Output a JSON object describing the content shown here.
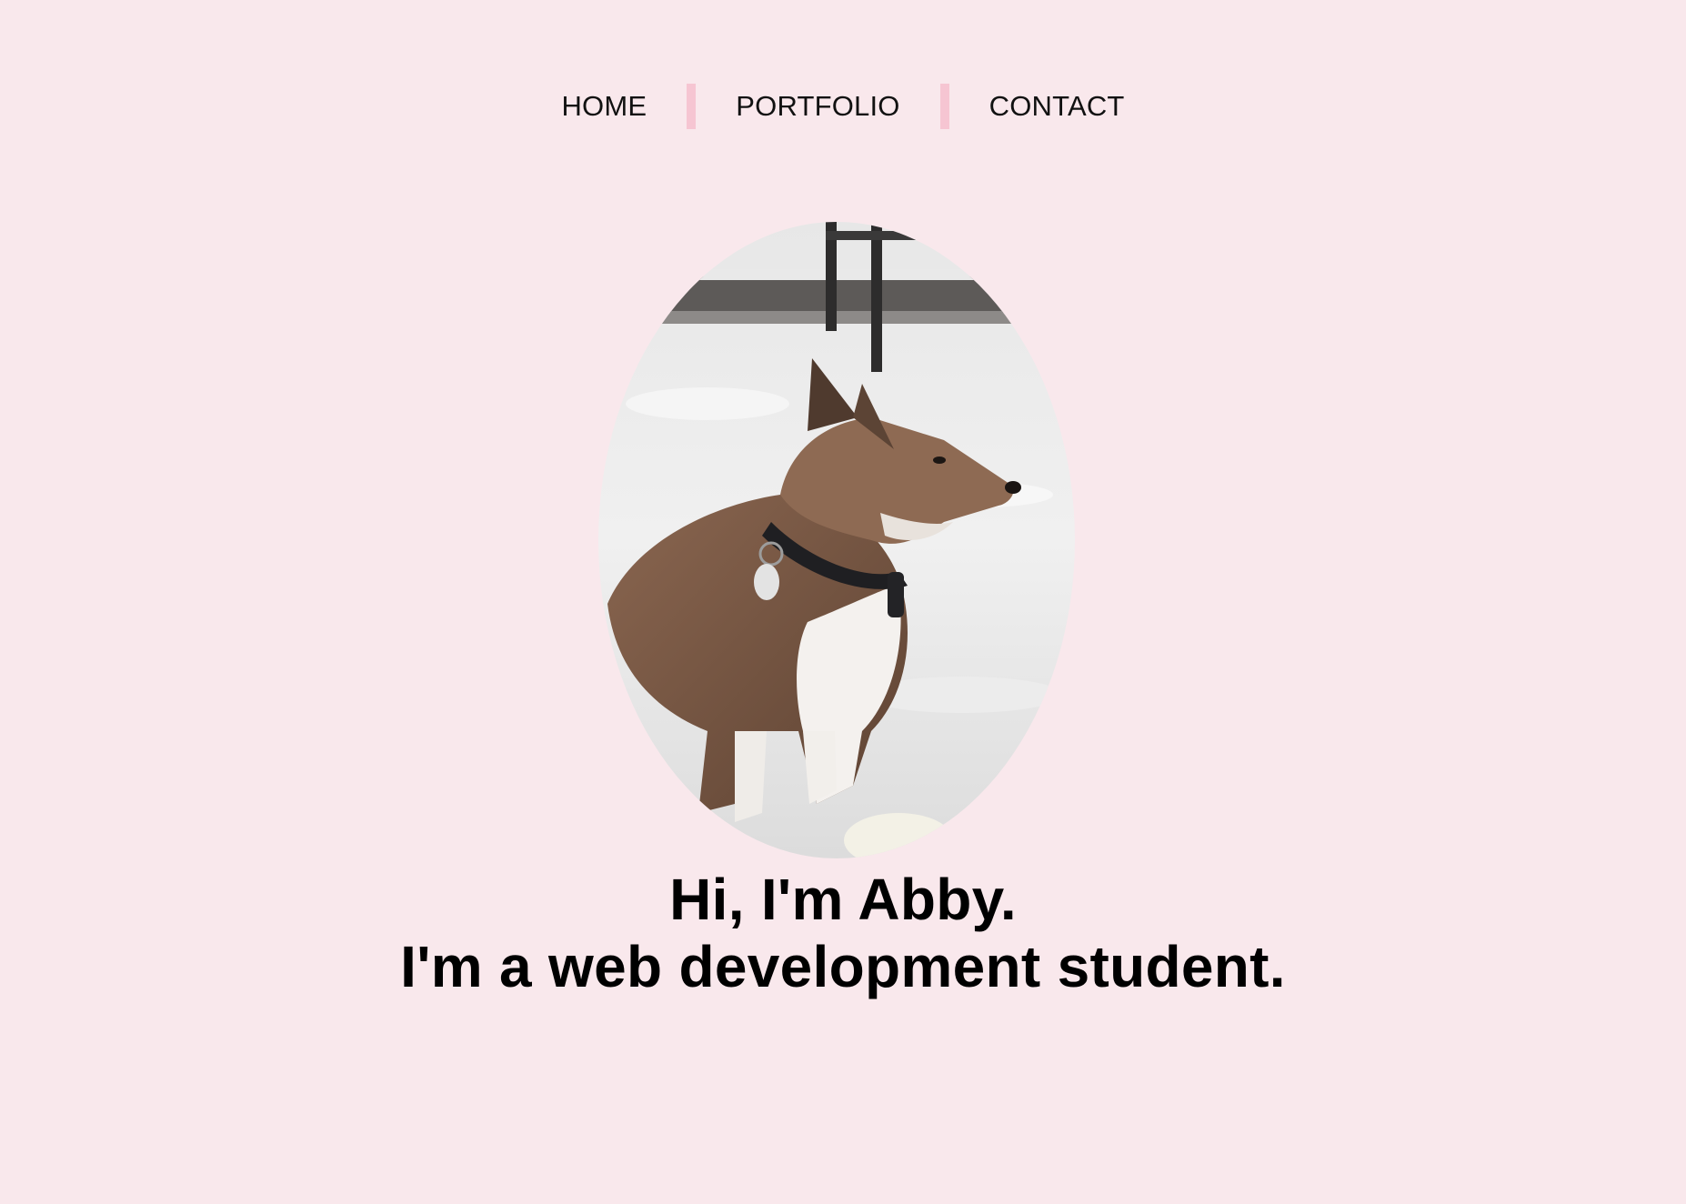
{
  "nav": {
    "items": [
      {
        "label": "HOME"
      },
      {
        "label": "PORTFOLIO"
      },
      {
        "label": "CONTACT"
      }
    ]
  },
  "hero": {
    "photo_icon": "dog-in-snow-photo",
    "line1": "Hi, I'm Abby.",
    "line2": "I'm a web development student."
  },
  "colors": {
    "background": "#f9e8ec",
    "nav_separator": "#f6c5d2",
    "text": "#000000"
  }
}
